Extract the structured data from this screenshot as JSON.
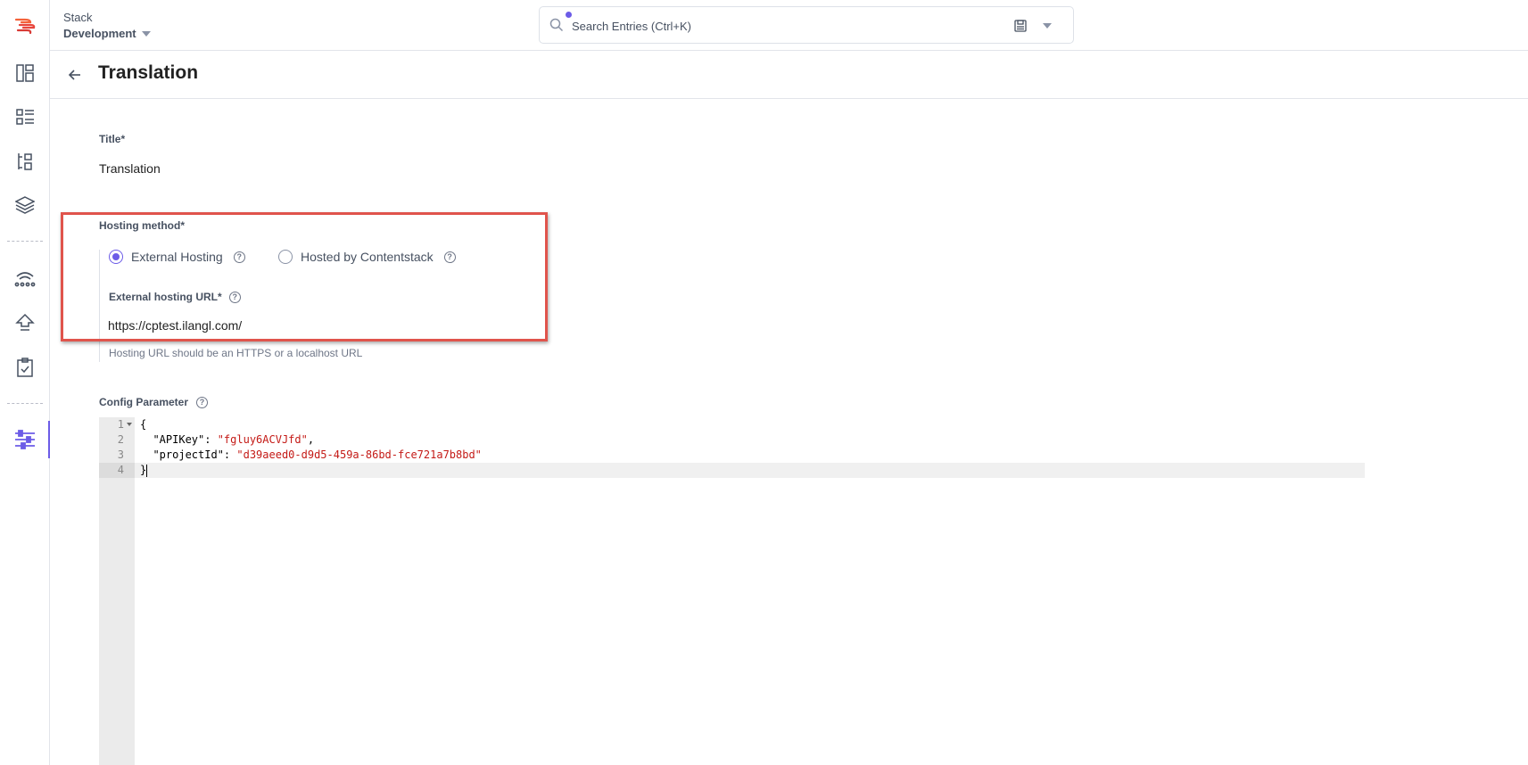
{
  "header": {
    "stack_label": "Stack",
    "stack_name": "Development",
    "search_placeholder": "Search Entries (Ctrl+K)"
  },
  "rail": {
    "icons": [
      "dashboard-icon",
      "entries-list-icon",
      "content-models-icon",
      "assets-layers-icon",
      "releases-icon",
      "publish-queue-icon",
      "tasks-icon",
      "settings-icon"
    ],
    "active": "settings-icon"
  },
  "page": {
    "title": "Translation"
  },
  "form": {
    "title_label": "Title*",
    "title_value": "Translation",
    "hosting_label": "Hosting method*",
    "hosting_options": [
      {
        "label": "External Hosting",
        "selected": true
      },
      {
        "label": "Hosted by Contentstack",
        "selected": false
      }
    ],
    "url_label": "External hosting URL*",
    "url_value": "https://cptest.ilangl.com/",
    "url_hint": "Hosting URL should be an HTTPS or a localhost URL",
    "config_label": "Config Parameter"
  },
  "editor": {
    "line_numbers": [
      "1",
      "2",
      "3",
      "4"
    ],
    "lines": [
      {
        "parts": [
          {
            "t": "{",
            "c": "p"
          }
        ]
      },
      {
        "parts": [
          {
            "t": "  \"APIKey\": ",
            "c": "p"
          },
          {
            "t": "\"fgluy6ACVJfd\"",
            "c": "s"
          },
          {
            "t": ",",
            "c": "p"
          }
        ]
      },
      {
        "parts": [
          {
            "t": "  \"projectId\": ",
            "c": "p"
          },
          {
            "t": "\"d39aeed0-d9d5-459a-86bd-fce721a7b8bd\"",
            "c": "s"
          }
        ]
      },
      {
        "parts": [
          {
            "t": "}",
            "c": "p"
          }
        ]
      }
    ]
  },
  "colors": {
    "accent": "#6c5ce7",
    "highlight_border": "#e0544c",
    "string": "#c41a16"
  }
}
